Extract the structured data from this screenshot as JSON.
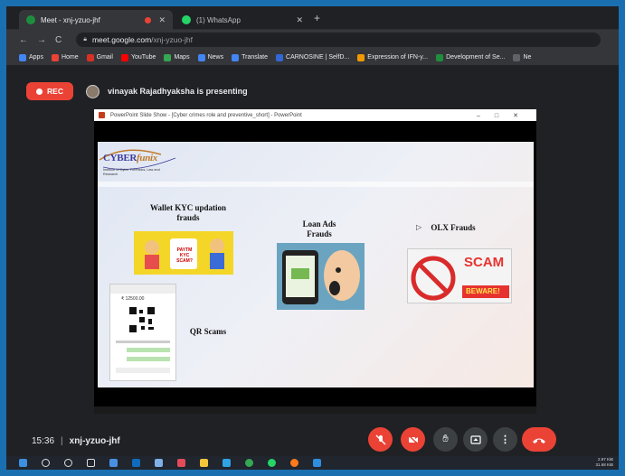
{
  "browser": {
    "tabs": [
      {
        "title": "Meet - xnj-yzuo-jhf",
        "active": true,
        "icon_color": "#1e8e3e"
      },
      {
        "title": "(1) WhatsApp",
        "active": false,
        "icon_color": "#25d366"
      }
    ],
    "new_tab_icon": "plus-icon",
    "url_host": "meet.google.com",
    "url_path": "/xnj-yzuo-jhf",
    "bookmarks": [
      {
        "label": "Apps",
        "color": "#4285f4"
      },
      {
        "label": "Home",
        "color": "#ea4335"
      },
      {
        "label": "Gmail",
        "color": "#d93025"
      },
      {
        "label": "YouTube",
        "color": "#ff0000"
      },
      {
        "label": "Maps",
        "color": "#34a853"
      },
      {
        "label": "News",
        "color": "#4285f4"
      },
      {
        "label": "Translate",
        "color": "#4285f4"
      },
      {
        "label": "CARNOSINE | SelfD...",
        "color": "#3367d6"
      },
      {
        "label": "Expression of IFN-y...",
        "color": "#f29900"
      },
      {
        "label": "Development of Se...",
        "color": "#1e8e3e"
      },
      {
        "label": "Ne",
        "color": "#5f6368"
      }
    ]
  },
  "meet": {
    "rec_label": "REC",
    "presenter_text": "vinayak Rajadhyaksha is presenting",
    "time": "15:36",
    "separator": "|",
    "meeting_code": "xnj-yzuo-jhf"
  },
  "presentation": {
    "window_title": "PowerPoint Slide Show - [Cyber crimes role and preventive_short] - PowerPoint",
    "logo_text": "CYBER",
    "logo_script": "funix",
    "logo_sub": "Institute of Cyber Forensics, Law and Research",
    "headings": {
      "wallet": "Wallet KYC updation frauds",
      "loan": "Loan Ads Frauds",
      "olx": "OLX Frauds",
      "qr": "QR Scams"
    },
    "wallet_img_text": "PAYTM KYC SCAM?",
    "olx_img_text_1": "SCAM",
    "olx_img_text_2": "BEWARE!",
    "qr_amount": "₹ 12500.00"
  },
  "accent": {
    "red": "#ea4335",
    "dark": "#202124"
  },
  "tray": {
    "line1": "2.97 KiB",
    "line2": "31.68 KiB"
  }
}
